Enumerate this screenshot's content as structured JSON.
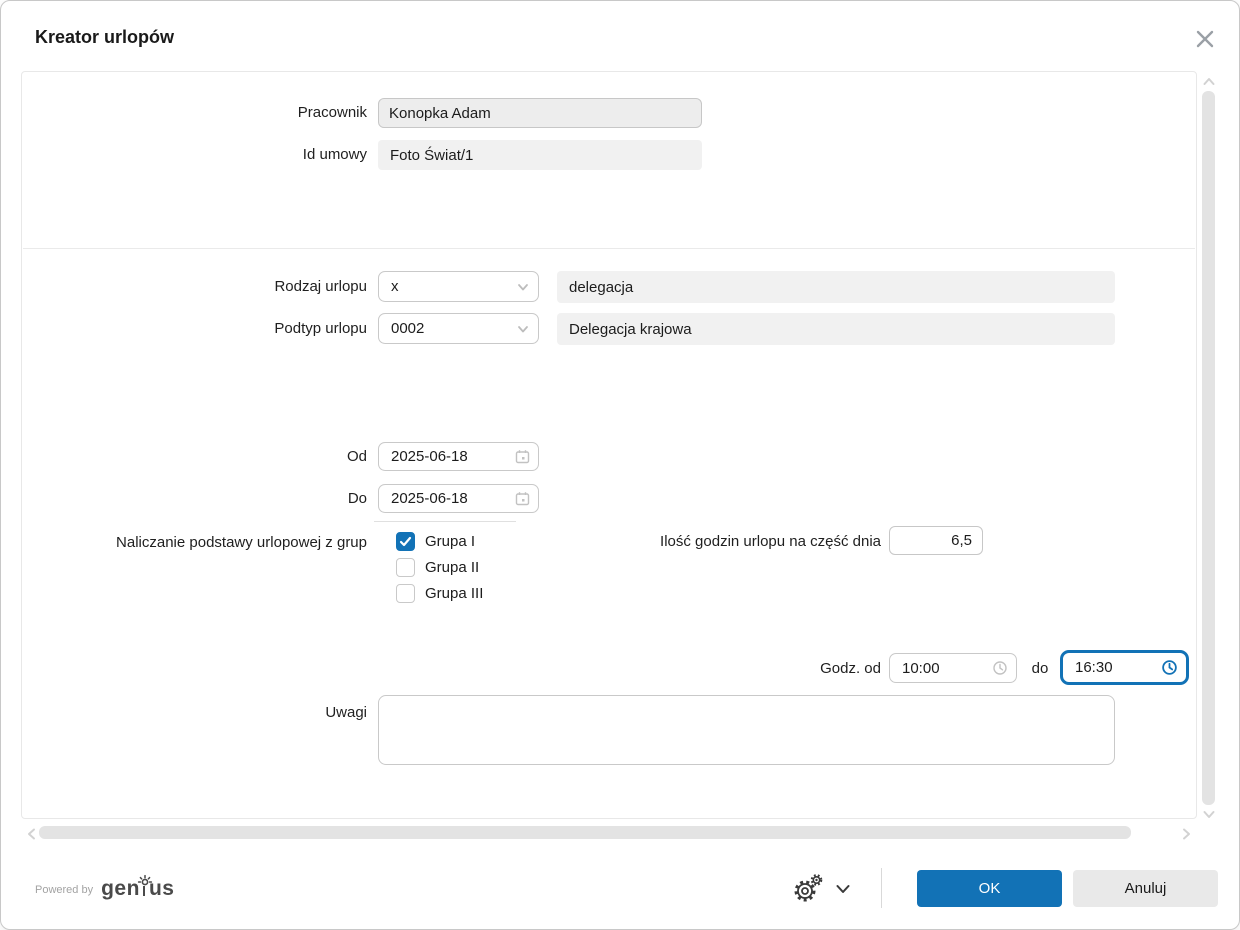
{
  "window": {
    "title": "Kreator urlopów"
  },
  "form": {
    "pracownik": {
      "label": "Pracownik",
      "value": "Konopka Adam"
    },
    "id_umowy": {
      "label": "Id umowy",
      "value": "Foto Świat/1"
    },
    "rodzaj_urlopu": {
      "label": "Rodzaj urlopu",
      "value": "x",
      "description": "delegacja"
    },
    "podtyp_urlopu": {
      "label": "Podtyp urlopu",
      "value": "0002",
      "description": "Delegacja krajowa"
    },
    "od": {
      "label": "Od",
      "value": "2025-06-18"
    },
    "do": {
      "label": "Do",
      "value": "2025-06-18"
    },
    "grupy": {
      "label": "Naliczanie podstawy urlopowej z grup",
      "options": [
        {
          "label": "Grupa I",
          "checked": true
        },
        {
          "label": "Grupa II",
          "checked": false
        },
        {
          "label": "Grupa III",
          "checked": false
        }
      ]
    },
    "ilosc_godzin": {
      "label": "Ilość godzin urlopu na część dnia",
      "value": "6,5"
    },
    "godziny": {
      "label_od": "Godz. od",
      "od_value": "10:00",
      "label_do": "do",
      "do_value": "16:30"
    },
    "uwagi": {
      "label": "Uwagi",
      "value": ""
    }
  },
  "footer": {
    "powered_by": "Powered by",
    "brand_gen": "gen",
    "brand_us": "us",
    "ok_label": "OK",
    "cancel_label": "Anuluj"
  },
  "icons": {
    "close": "close-icon",
    "calendar": "calendar-icon",
    "clock": "clock-icon",
    "gear": "gear-icon",
    "chevron_down": "chevron-down-icon"
  },
  "colors": {
    "accent_blue": "#1272b6",
    "field_gray": "#f1f1f1",
    "disabled_gray": "#ededed",
    "border_gray": "#c9c9c9"
  }
}
